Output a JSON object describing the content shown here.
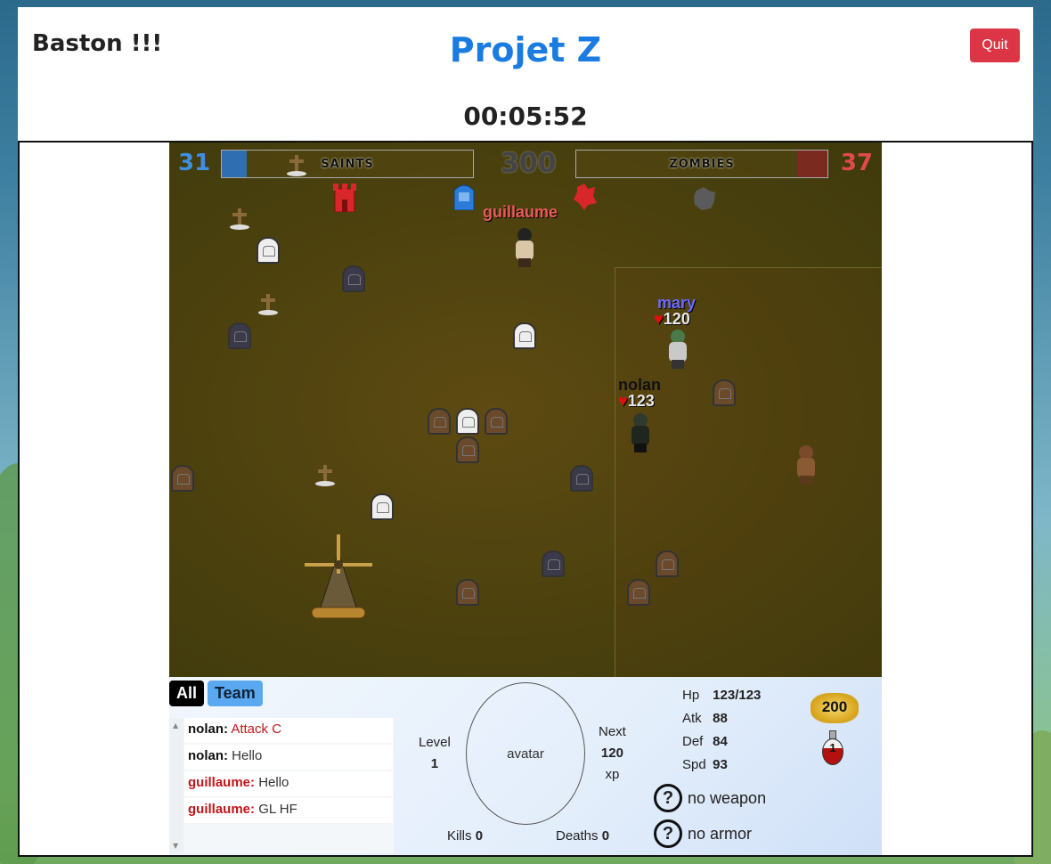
{
  "header": {
    "subtitle": "Baston !!!",
    "title": "Projet Z",
    "quit_label": "Quit",
    "timer": "00:05:52"
  },
  "game": {
    "score_left": "31",
    "score_center": "300",
    "score_right": "37",
    "team_left": {
      "name": "SAINTS",
      "color": "#2f6fb0",
      "fill": 0.1
    },
    "team_right": {
      "name": "ZOMBIES",
      "color": "#7a2a1e",
      "fill": 0.12
    },
    "players": [
      {
        "name": "guillaume",
        "color": "#e85a5a",
        "hp": ""
      },
      {
        "name": "mary",
        "color": "#6b6bff",
        "hp": "120"
      },
      {
        "name": "nolan",
        "color": "#111111",
        "hp": "123"
      }
    ]
  },
  "hud": {
    "tabs": {
      "all": "All",
      "team": "Team"
    },
    "chat": [
      {
        "who": "nolan:",
        "text": "Attack C",
        "who_color": "black",
        "text_color": "red"
      },
      {
        "who": "nolan:",
        "text": "Hello",
        "who_color": "black",
        "text_color": "normal"
      },
      {
        "who": "guillaume:",
        "text": "Hello",
        "who_color": "red",
        "text_color": "normal"
      },
      {
        "who": "guillaume:",
        "text": "GL HF",
        "who_color": "red",
        "text_color": "normal"
      }
    ],
    "level_label": "Level",
    "level_value": "1",
    "avatar_label": "avatar",
    "next_label": "Next",
    "next_value": "120",
    "xp_label": "xp",
    "kills_label": "Kills",
    "kills_value": "0",
    "deaths_label": "Deaths",
    "deaths_value": "0",
    "stats": {
      "hp_label": "Hp",
      "hp_value": "123/123",
      "atk_label": "Atk",
      "atk_value": "88",
      "def_label": "Def",
      "def_value": "84",
      "spd_label": "Spd",
      "spd_value": "93"
    },
    "weapon": "no weapon",
    "armor": "no armor",
    "gold": "200",
    "potions": "1",
    "icons": {
      "unknown_item": "question-mark-icon",
      "gold": "gold-coins-icon",
      "potion": "health-potion-icon"
    }
  }
}
